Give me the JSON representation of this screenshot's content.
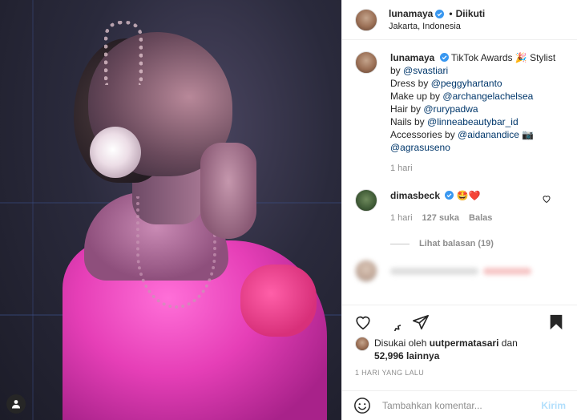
{
  "post": {
    "username": "lunamaya",
    "follow_status": "Diikuti",
    "location": "Jakarta, Indonesia"
  },
  "caption": {
    "username": "lunamaya",
    "line1_text": "TikTok Awards",
    "line1_emoji": "🎉",
    "line1_end": "Stylist",
    "by_prefix": "by",
    "stylist": "@svastiari",
    "dress_prefix": "Dress by",
    "dress": "@peggyhartanto",
    "makeup_prefix": "Make up by",
    "makeup": "@archangelachelsea",
    "hair_prefix": "Hair by",
    "hair": "@rurypadwa",
    "nails_prefix": "Nails by",
    "nails": "@linneabeautybar_id",
    "acc_prefix": "Accessories by",
    "acc": "@aidanandice",
    "acc_emoji": "📷",
    "acc2": "@agrasuseno",
    "time": "1 hari"
  },
  "comment": {
    "username": "dimasbeck",
    "text": "🤩❤️",
    "time": "1 hari",
    "likes": "127 suka",
    "reply": "Balas",
    "view_replies": "Lihat balasan (19)"
  },
  "likes": {
    "prefix": "Disukai oleh",
    "liker": "uutpermatasari",
    "conj": "dan",
    "count": "52,996 lainnya"
  },
  "posted_ago": "1 HARI YANG LALU",
  "comment_input": {
    "placeholder": "Tambahkan komentar...",
    "post_label": "Kirim"
  },
  "colors": {
    "link": "#00376b",
    "verified": "#3897f0",
    "post_disabled": "#b2dffc"
  }
}
